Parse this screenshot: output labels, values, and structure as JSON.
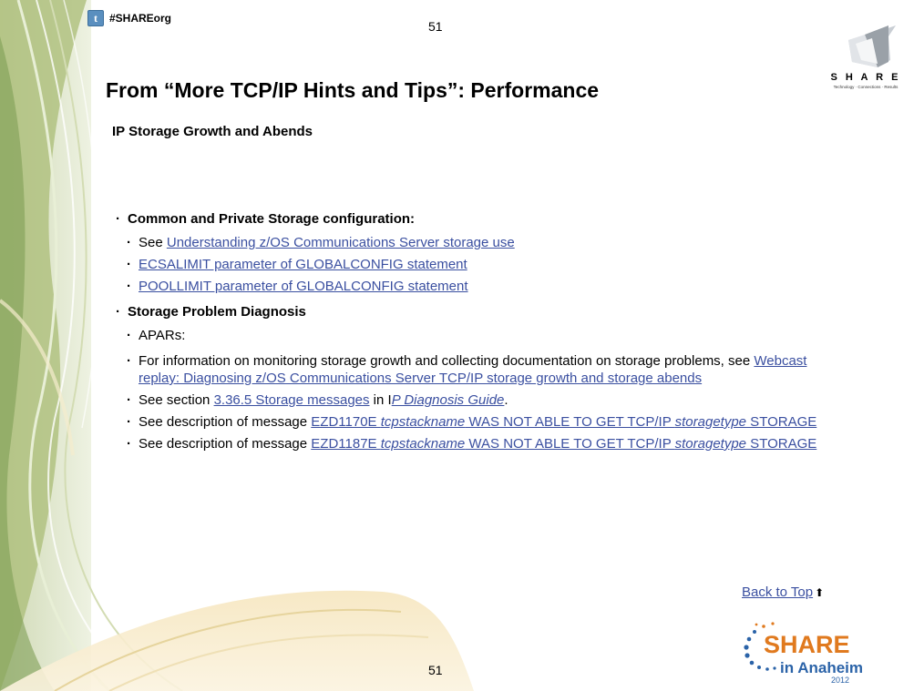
{
  "page_number": "51",
  "twitter": {
    "icon": "twitter-icon",
    "handle": "#SHAREorg"
  },
  "title": "From “More TCP/IP Hints and Tips”:  Performance",
  "subtitle": "IP Storage Growth and Abends",
  "logo_top": {
    "text": "S H A R E",
    "tagline": "Technology · Connections · Results"
  },
  "sections": [
    {
      "heading": "Common and Private Storage configuration:",
      "items": [
        {
          "prefix": "See ",
          "link": "Understanding z/OS Communications Server storage use"
        },
        {
          "link": "ECSALIMIT parameter of GLOBALCONFIG statement"
        },
        {
          "link": "POOLLIMIT parameter of GLOBALCONFIG statement"
        }
      ]
    },
    {
      "heading": "Storage Problem Diagnosis",
      "items": [
        {
          "text": "APARs:"
        },
        {
          "prefix": "For information on monitoring storage growth and collecting documentation on storage problems, see ",
          "link": "Webcast replay: Diagnosing z/OS Communications Server TCP/IP storage growth and storage abends"
        },
        {
          "prefix": "See section ",
          "link": "3.36.5 Storage messages",
          "middle": " in I",
          "link2": "P Diagnosis Guide",
          "suffix": "."
        },
        {
          "prefix": "See description of message ",
          "link_a": "EZD1170E ",
          "link_b": "tcpstackname",
          "link_c": " WAS NOT ABLE TO GET TCP/IP ",
          "link_d": "storagetype",
          "link_e": " STORAGE"
        },
        {
          "prefix": "See description of message ",
          "link_a": "EZD1187E ",
          "link_b": "tcpstackname",
          "link_c": " WAS NOT ABLE TO GET TCP/IP ",
          "link_d": "storagetype",
          "link_e": " STORAGE"
        }
      ]
    }
  ],
  "back_to_top": "Back to Top",
  "back_to_top_icon": "up-arrow-icon",
  "event_logo": {
    "share": "SHARE",
    "location": "in Anaheim",
    "year": "2012"
  },
  "colors": {
    "link": "#3a4fa0",
    "share_orange": "#e07a1f",
    "share_blue": "#2b63a8",
    "swirl_green": "#b9c98a"
  }
}
